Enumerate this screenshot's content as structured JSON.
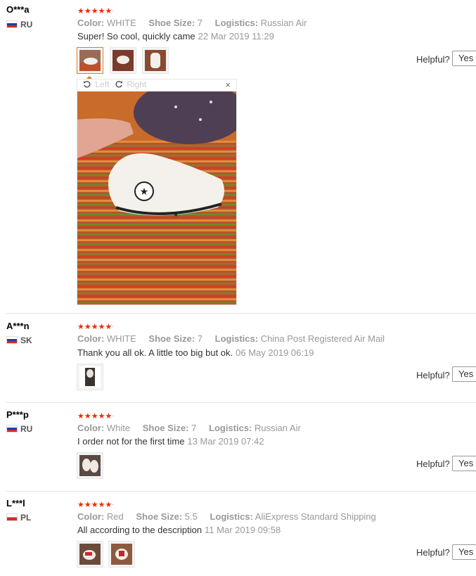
{
  "colors": {
    "accent": "#e62e04",
    "muted": "#999999",
    "active_thumb": "#e07b20"
  },
  "reviews": [
    {
      "user": "O***a",
      "country": "RU",
      "stars": "★★★★★",
      "color_label": "Color:",
      "color": "WHITE",
      "size_label": "Shoe Size:",
      "size": "7",
      "logistics_label": "Logistics:",
      "logistics": "Russian Air",
      "feedback": "Super! So cool, quickly came",
      "date": "22 Mar 2019 11:29",
      "helpful": "Helpful?",
      "yes": "Yes ("
    },
    {
      "user": "A***n",
      "country": "SK",
      "stars": "★★★★★",
      "color_label": "Color:",
      "color": "WHITE",
      "size_label": "Shoe Size:",
      "size": "7",
      "logistics_label": "Logistics:",
      "logistics": "China Post Registered Air Mail",
      "feedback": "Thank you all ok. A little too big but ok.",
      "date": "06 May 2019 06:19",
      "helpful": "Helpful?",
      "yes": "Yes ("
    },
    {
      "user": "P***p",
      "country": "RU",
      "stars": "★★★★★",
      "color_label": "Color:",
      "color": "White",
      "size_label": "Shoe Size:",
      "size": "7",
      "logistics_label": "Logistics:",
      "logistics": "Russian Air",
      "feedback": "I order not for the first time",
      "date": "13 Mar 2019 07:42",
      "helpful": "Helpful?",
      "yes": "Yes ("
    },
    {
      "user": "L***l",
      "country": "PL",
      "stars": "★★★★★",
      "color_label": "Color:",
      "color": "Red",
      "size_label": "Shoe Size:",
      "size": "5.5",
      "logistics_label": "Logistics:",
      "logistics": "AliExpress Standard Shipping",
      "feedback": "All according to the description",
      "date": "11 Mar 2019 09:58",
      "helpful": "Helpful?",
      "yes": "Yes ("
    }
  ],
  "viewer": {
    "left": "Left",
    "right": "Right",
    "close": "×",
    "rotate_left_icon": "rotate-left-icon",
    "rotate_right_icon": "rotate-right-icon"
  }
}
